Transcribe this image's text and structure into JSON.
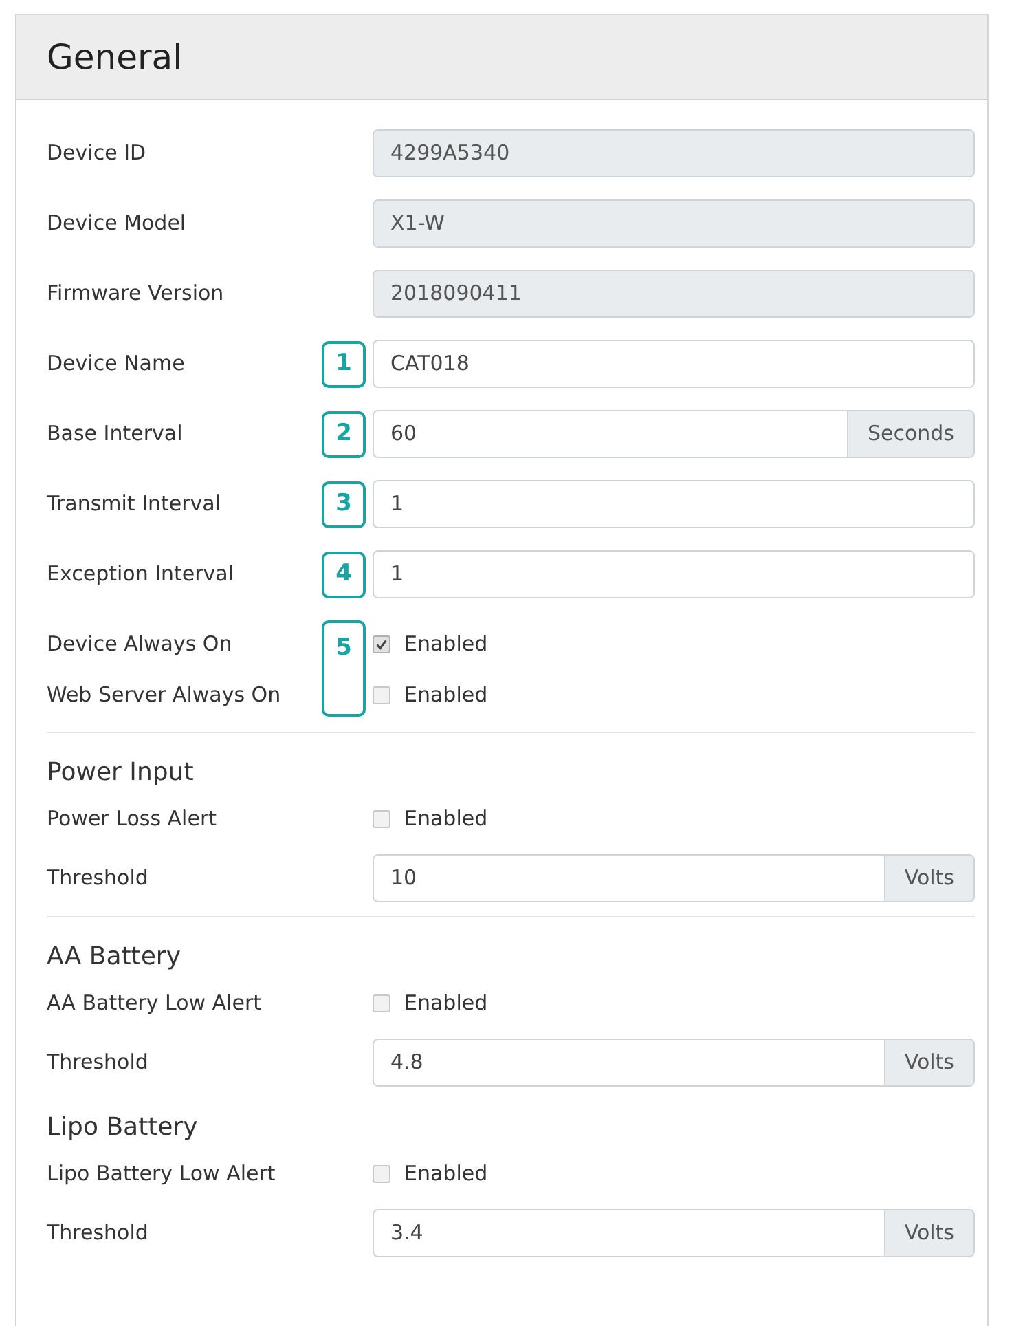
{
  "panel": {
    "title": "General"
  },
  "sections": [
    {
      "divider": false,
      "rows": [
        {
          "kind": "readonly",
          "label": "Device ID",
          "value": "4299A5340"
        },
        {
          "kind": "readonly",
          "label": "Device Model",
          "value": "X1-W"
        },
        {
          "kind": "readonly",
          "label": "Firmware Version",
          "value": "2018090411"
        },
        {
          "kind": "input",
          "label": "Device Name",
          "value": "CAT018",
          "callout": "1"
        },
        {
          "kind": "addon",
          "label": "Base Interval",
          "value": "60",
          "addon": "Seconds",
          "callout": "2"
        },
        {
          "kind": "input",
          "label": "Transmit Interval",
          "value": "1",
          "callout": "3"
        },
        {
          "kind": "input",
          "label": "Exception Interval",
          "value": "1",
          "callout": "4"
        },
        {
          "kind": "group",
          "callout": "5",
          "rows": [
            {
              "label": "Device Always On",
              "option": "Enabled",
              "checked": true
            },
            {
              "label": "Web Server Always On",
              "option": "Enabled",
              "checked": false
            }
          ]
        }
      ]
    },
    {
      "divider": true,
      "title": "Power Input",
      "rows": [
        {
          "kind": "checkbox",
          "label": "Power Loss Alert",
          "option": "Enabled",
          "checked": false
        },
        {
          "kind": "addon",
          "label": "Threshold",
          "value": "10",
          "addon": "Volts"
        }
      ]
    },
    {
      "divider": true,
      "title": "AA Battery",
      "rows": [
        {
          "kind": "checkbox",
          "label": "AA Battery Low Alert",
          "option": "Enabled",
          "checked": false
        },
        {
          "kind": "addon",
          "label": "Threshold",
          "value": "4.8",
          "addon": "Volts"
        }
      ]
    },
    {
      "divider": false,
      "title": "Lipo Battery",
      "rows": [
        {
          "kind": "checkbox",
          "label": "Lipo Battery Low Alert",
          "option": "Enabled",
          "checked": false
        },
        {
          "kind": "addon",
          "label": "Threshold",
          "value": "3.4",
          "addon": "Volts"
        }
      ]
    }
  ]
}
